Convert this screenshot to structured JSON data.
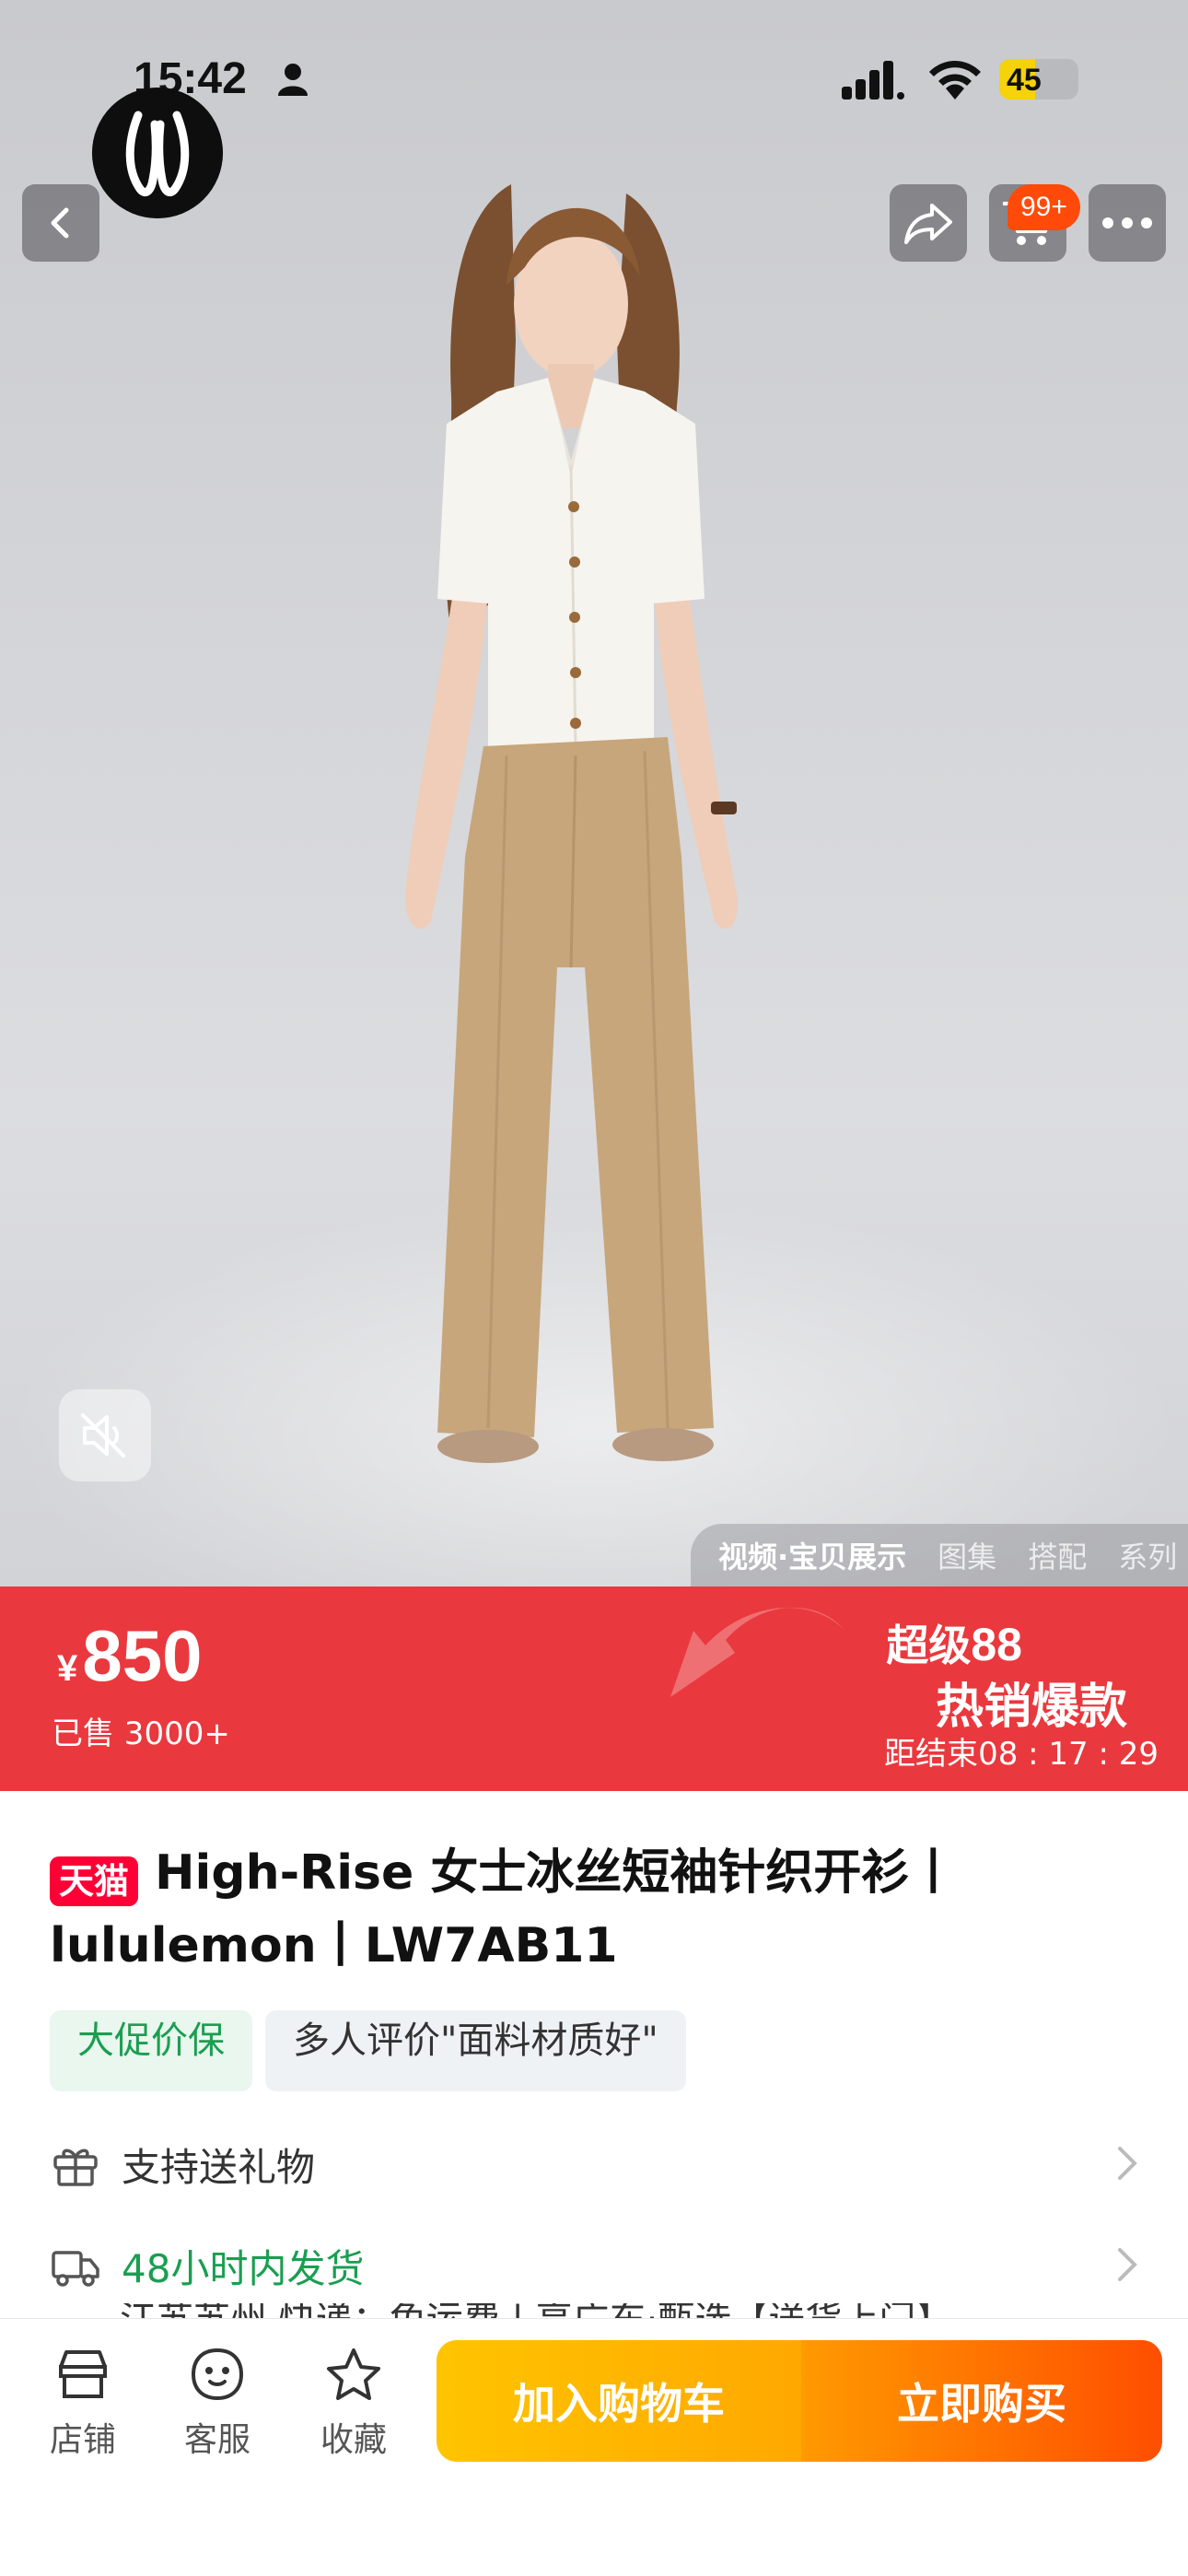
{
  "status_bar": {
    "time": "15:42",
    "battery": "45",
    "battery_level": 0.45
  },
  "media_tabs": [
    {
      "label": "视频·宝贝展示",
      "active": true
    },
    {
      "label": "图集",
      "active": false
    },
    {
      "label": "搭配",
      "active": false
    },
    {
      "label": "系列",
      "active": false
    }
  ],
  "header": {
    "cart_badge": "99+"
  },
  "price": {
    "currency": "¥",
    "value": "850",
    "sold": "已售 3000+"
  },
  "promo": {
    "line1_prefix": "超级",
    "line1_num": "88",
    "line2": "热销爆款",
    "countdown_label": "距结束",
    "countdown": "08 : 17 : 29"
  },
  "product": {
    "badge": "天猫",
    "title": "High-Rise 女士冰丝短袖针织开衫丨lululemon丨LW7AB11"
  },
  "tags": [
    "大促价保",
    "多人评价\"面料材质好\""
  ],
  "info": {
    "gift": "支持送礼物",
    "shipping": "48小时内发货",
    "shipping_detail": "江苏苏州 快递：免运费 | 享广东·甄选【送货上门】"
  },
  "bottom_nav": {
    "shop": "店铺",
    "service": "客服",
    "favorite": "收藏"
  },
  "actions": {
    "add_to_cart": "加入购物车",
    "buy_now": "立即购买"
  },
  "colors": {
    "price_banner": "#e9393e",
    "tmall_red": "#ff0036",
    "green": "#1a9e50",
    "cta_yellow": "#ffb800",
    "cta_orange": "#ff5a00"
  },
  "icons": [
    "back-icon",
    "share-icon",
    "cart-icon",
    "more-icon",
    "mute-icon",
    "gift-icon",
    "truck-icon",
    "chevron-right-icon",
    "shop-icon",
    "service-icon",
    "star-icon"
  ]
}
